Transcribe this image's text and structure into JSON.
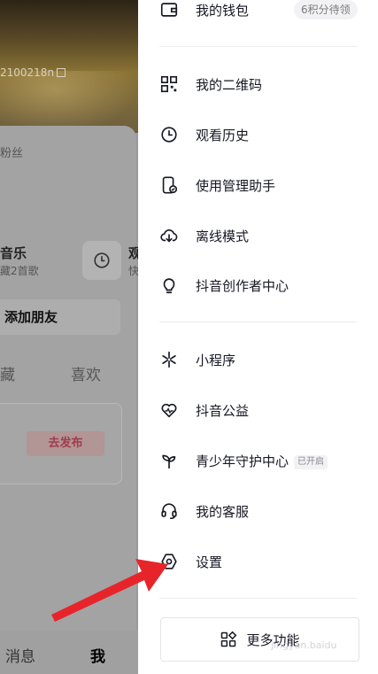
{
  "background_profile": {
    "user_id_fragment": "2100218n",
    "fans_label": "粉丝",
    "music_title": "音乐",
    "music_subtitle": "藏2首歌",
    "right_card_title": "观",
    "right_card_subtitle": "快",
    "add_friend_label": "添加朋友",
    "tab_collect": "藏",
    "tab_like": "喜欢",
    "publish_button": "去发布",
    "nav_messages": "消息",
    "nav_me": "我"
  },
  "drawer": {
    "wallet": {
      "label": "我的钱包",
      "badge": "6积分待领"
    },
    "group2": [
      {
        "label": "我的二维码",
        "icon": "qr-code-icon"
      },
      {
        "label": "观看历史",
        "icon": "clock-icon"
      },
      {
        "label": "使用管理助手",
        "icon": "phone-manage-icon"
      },
      {
        "label": "离线模式",
        "icon": "cloud-download-icon"
      },
      {
        "label": "抖音创作者中心",
        "icon": "lightbulb-icon"
      }
    ],
    "group3": [
      {
        "label": "小程序",
        "icon": "mini-program-icon"
      },
      {
        "label": "抖音公益",
        "icon": "charity-heart-icon"
      },
      {
        "label": "青少年守护中心",
        "icon": "sprout-icon",
        "tag": "已开启"
      },
      {
        "label": "我的客服",
        "icon": "headset-icon"
      },
      {
        "label": "设置",
        "icon": "settings-hexagon-icon"
      }
    ],
    "more_button": "更多功能"
  },
  "watermark": "jingyan.baidu",
  "colors": {
    "arrow": "#e8242b",
    "text": "#161823",
    "badge_bg": "#f2f2f4"
  }
}
